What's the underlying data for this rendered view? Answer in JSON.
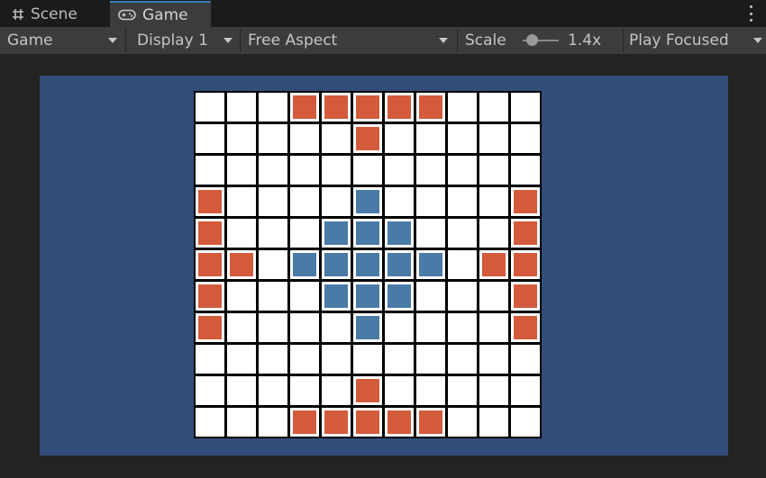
{
  "tabs": [
    {
      "label": "Scene",
      "icon": "hash-icon",
      "active": false
    },
    {
      "label": "Game",
      "icon": "gamepad-icon",
      "active": true
    }
  ],
  "toolbar": {
    "game_view_label": "Game",
    "display_label": "Display 1",
    "aspect_label": "Free Aspect",
    "scale_label": "Scale",
    "scale_value": "1.4x",
    "play_mode_label": "Play Focused"
  },
  "colors": {
    "camera_background": "#334d7a",
    "attacker": "#d35b3b",
    "defender": "#4a7aa6",
    "cell": "#ffffff",
    "grid_line": "#000000"
  },
  "board": {
    "rows": 11,
    "cols": 11,
    "layout": [
      "...RRRRR...",
      ".....R.....",
      "...........",
      "R....B....R",
      "R...BBB...R",
      "RR.BBBBB.RR",
      "R...BBB...R",
      "R....B....R",
      "...........",
      ".....R.....",
      "...RRRRR..."
    ]
  }
}
